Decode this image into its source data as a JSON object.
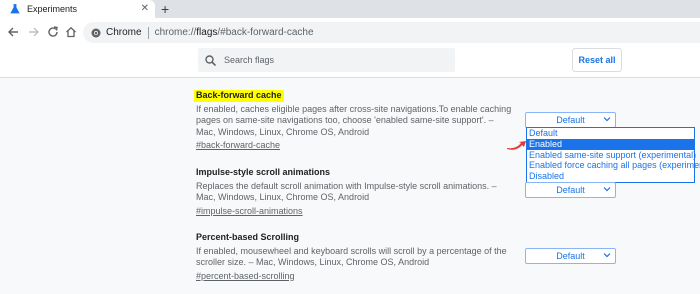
{
  "browser": {
    "tab": {
      "title": "Experiments",
      "close_glyph": "✕"
    },
    "new_tab_glyph": "+",
    "omnibox": {
      "site_name": "Chrome",
      "url_prefix": "chrome://",
      "url_host": "flags",
      "url_path": "/#back-forward-cache"
    }
  },
  "flags": {
    "search_placeholder": "Search flags",
    "reset_label": "Reset all"
  },
  "experiments": [
    {
      "title": "Back-forward cache",
      "highlighted": true,
      "description": "If enabled, caches eligible pages after cross-site navigations.To enable caching pages on same-site navigations too, choose 'enabled same-site support'. – Mac, Windows, Linux, Chrome OS, Android",
      "link": "#back-forward-cache",
      "selected": "Default"
    },
    {
      "title": "Impulse-style scroll animations",
      "description": "Replaces the default scroll animation with Impulse-style scroll animations. – Mac, Windows, Linux, Chrome OS, Android",
      "link": "#impulse-scroll-animations",
      "selected": "Default"
    },
    {
      "title": "Percent-based Scrolling",
      "description": "If enabled, mousewheel and keyboard scrolls will scroll by a percentage of the scroller size. – Mac, Windows, Linux, Chrome OS, Android",
      "link": "#percent-based-scrolling",
      "selected": "Default"
    }
  ],
  "dropdown": {
    "options": [
      "Default",
      "Enabled",
      "Enabled same-site support (experimental)",
      "Enabled force caching all pages (experimental)",
      "Disabled"
    ],
    "highlighted_index": 1
  },
  "colors": {
    "accent": "#1a73e8",
    "highlight": "#ffff00",
    "arrow": "#e53935"
  },
  "icons": [
    "flask-icon",
    "close-icon",
    "back-arrow-icon",
    "forward-arrow-icon",
    "reload-icon",
    "home-icon",
    "chrome-icon",
    "search-icon",
    "chevron-down-icon",
    "red-arrow-icon"
  ]
}
